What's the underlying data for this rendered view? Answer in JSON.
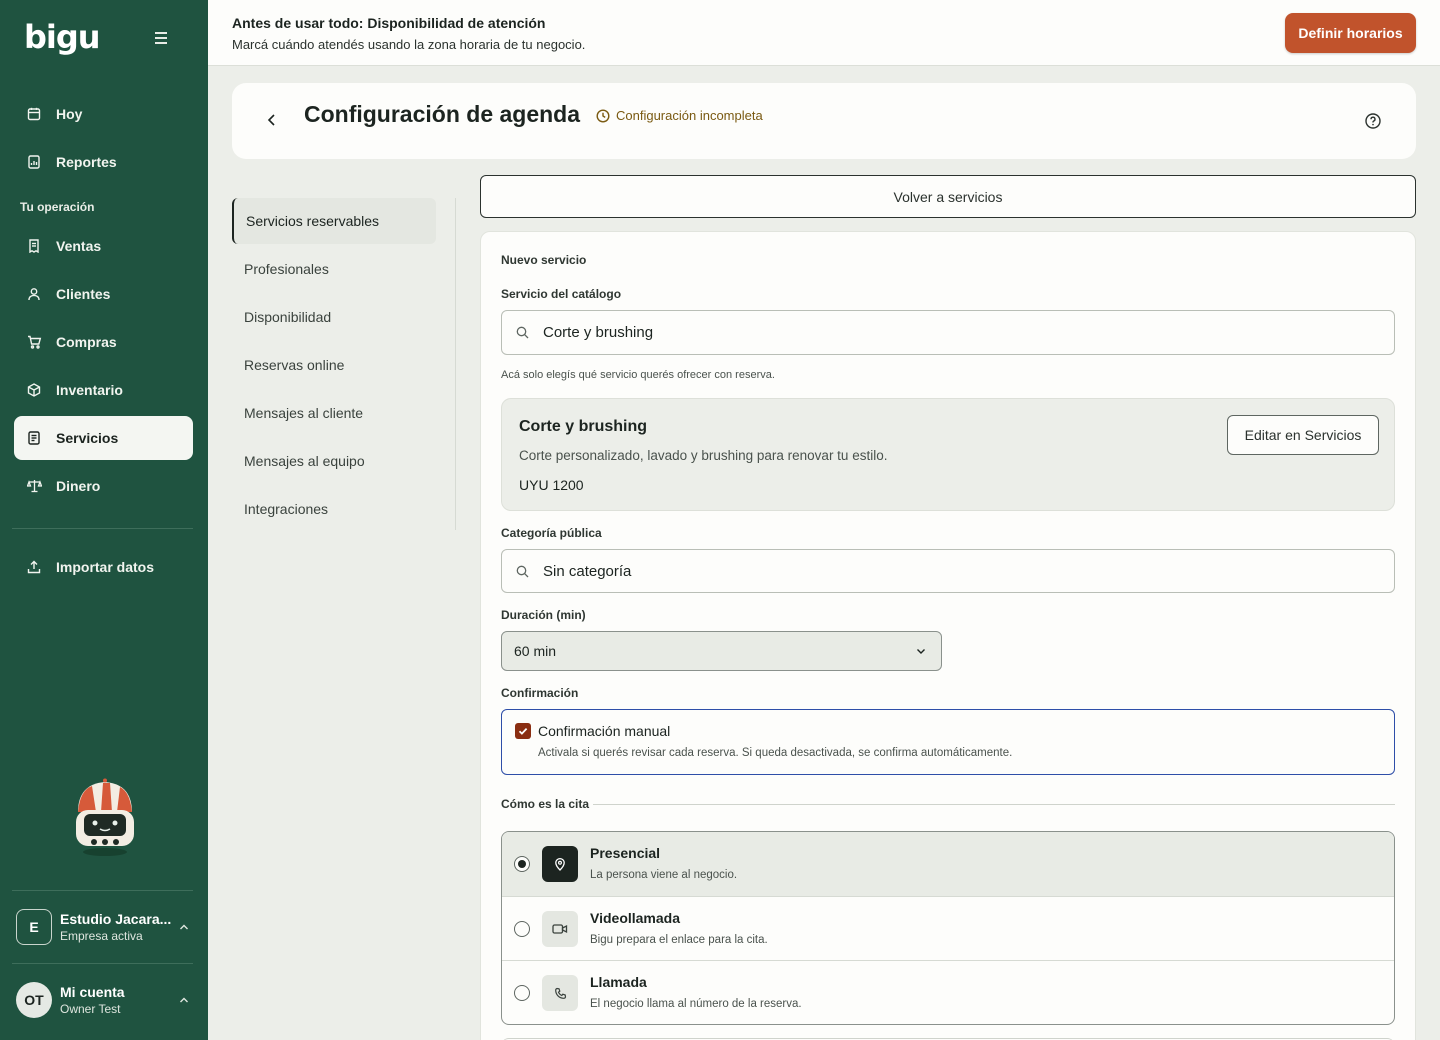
{
  "brand": {
    "logo": "bigu"
  },
  "sidebar": {
    "items_top": [
      {
        "label": "Hoy",
        "icon": "calendar-icon"
      },
      {
        "label": "Reportes",
        "icon": "report-icon"
      }
    ],
    "section_title": "Tu operación",
    "items": [
      {
        "label": "Ventas",
        "icon": "receipt-icon"
      },
      {
        "label": "Clientes",
        "icon": "user-icon"
      },
      {
        "label": "Compras",
        "icon": "cart-icon"
      },
      {
        "label": "Inventario",
        "icon": "box-icon"
      },
      {
        "label": "Servicios",
        "icon": "document-icon",
        "active": true
      },
      {
        "label": "Dinero",
        "icon": "scale-icon"
      }
    ],
    "import": {
      "label": "Importar datos",
      "icon": "upload-icon"
    },
    "company": {
      "initial": "E",
      "name": "Estudio Jacara...",
      "subtitle": "Empresa activa"
    },
    "account": {
      "initials": "OT",
      "name": "Mi cuenta",
      "subtitle": "Owner Test"
    }
  },
  "banner": {
    "title": "Antes de usar todo: Disponibilidad de atención",
    "subtitle": "Marcá cuándo atendés usando la zona horaria de tu negocio.",
    "button": "Definir horarios"
  },
  "header": {
    "title": "Configuración de agenda",
    "status": "Configuración incompleta",
    "colors": {
      "status": "#7a5a12"
    }
  },
  "subnav": {
    "items": [
      {
        "label": "Servicios reservables",
        "active": true
      },
      {
        "label": "Profesionales"
      },
      {
        "label": "Disponibilidad"
      },
      {
        "label": "Reservas online"
      },
      {
        "label": "Mensajes al cliente"
      },
      {
        "label": "Mensajes al equipo"
      },
      {
        "label": "Integraciones"
      }
    ]
  },
  "content": {
    "back_button": "Volver a servicios",
    "section_title": "Nuevo servicio",
    "catalog_label": "Servicio del catálogo",
    "catalog_value": "Corte y brushing",
    "catalog_hint": "Acá solo elegís qué servicio querés ofrecer con reserva.",
    "service": {
      "name": "Corte y brushing",
      "description": "Corte personalizado, lavado y brushing para renovar tu estilo.",
      "price": "UYU 1200",
      "edit_button": "Editar en Servicios"
    },
    "category_label": "Categoría pública",
    "category_value": "Sin categoría",
    "duration_label": "Duración (min)",
    "duration_value": "60 min",
    "confirmation_label": "Confirmación",
    "confirmation": {
      "title": "Confirmación manual",
      "subtitle": "Activala si querés revisar cada reserva. Si queda desactivada, se confirma automáticamente.",
      "checked": true
    },
    "modality_label": "Cómo es la cita",
    "modalities": [
      {
        "title": "Presencial",
        "subtitle": "La persona viene al negocio.",
        "icon": "location-pin-icon",
        "selected": true
      },
      {
        "title": "Videollamada",
        "subtitle": "Bigu prepara el enlace para la cita.",
        "icon": "video-camera-icon",
        "selected": false
      },
      {
        "title": "Llamada",
        "subtitle": "El negocio llama al número de la reserva.",
        "icon": "phone-icon",
        "selected": false
      }
    ]
  },
  "colors": {
    "sidebar": "#1f5340",
    "accent": "#c1532c",
    "focus": "#2e4ea8",
    "checkbox": "#8a2e12"
  }
}
